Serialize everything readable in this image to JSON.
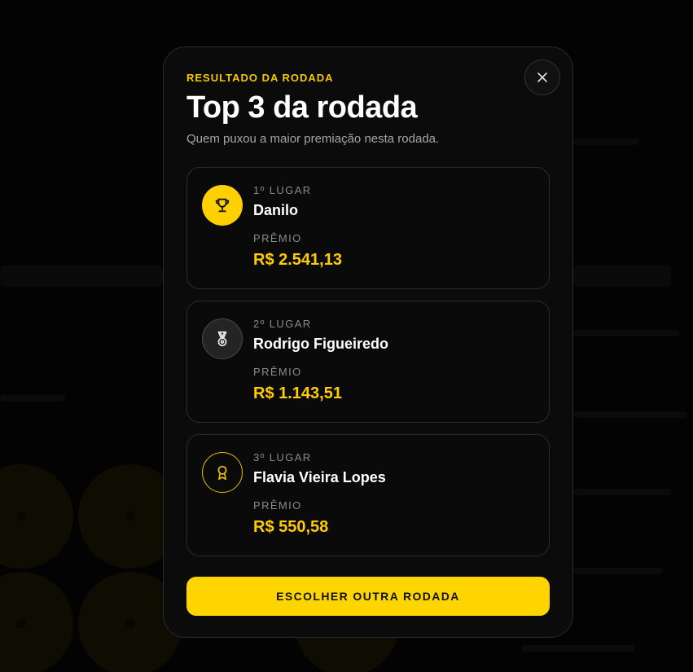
{
  "modal": {
    "eyebrow": "RESULTADO DA RODADA",
    "title": "Top 3 da rodada",
    "subtitle": "Quem puxou a maior premiação nesta rodada.",
    "close_icon": "close-icon"
  },
  "winners": [
    {
      "place": "1º LUGAR",
      "name": "Danilo",
      "prize_label": "PRÊMIO",
      "prize_value": "R$ 2.541,13",
      "icon": "trophy-icon"
    },
    {
      "place": "2º LUGAR",
      "name": "Rodrigo Figueiredo",
      "prize_label": "PRÊMIO",
      "prize_value": "R$ 1.143,51",
      "icon": "medal-icon"
    },
    {
      "place": "3º LUGAR",
      "name": "Flavia Vieira Lopes",
      "prize_label": "PRÊMIO",
      "prize_value": "R$ 550,58",
      "icon": "award-icon"
    }
  ],
  "cta": {
    "label": "ESCOLHER OUTRA RODADA"
  },
  "colors": {
    "accent": "#ffd000",
    "prize": "#ffcc00",
    "background": "#0b0b0b"
  }
}
